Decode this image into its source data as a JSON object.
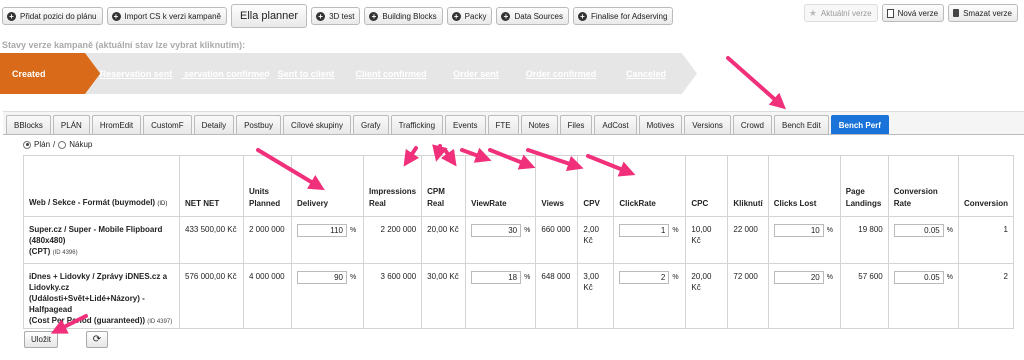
{
  "toolbar": {
    "add_position": "Přidat pozici do plánu",
    "import_cs": "Import CS k verzi kampaně",
    "ella_planner": "Ella planner",
    "test_3d": "3D test",
    "building_blocks": "Building Blocks",
    "packy": "Packy",
    "data_sources": "Data Sources",
    "finalise": "Finalise for Adserving",
    "current_version": "Aktuální verze",
    "new_version": "Nová verze",
    "delete_version": "Smazat verze"
  },
  "status": {
    "title": "Stavy verze kampaně (aktuální stav lze vybrat kliknutím):",
    "steps": [
      {
        "label": "Created"
      },
      {
        "label": "Reservation sent"
      },
      {
        "label": "Reservation confirmed"
      },
      {
        "label": "Sent to client"
      },
      {
        "label": "Client confirmed"
      },
      {
        "label": "Order sent"
      },
      {
        "label": "Order confirmed"
      },
      {
        "label": "Canceled"
      }
    ],
    "active_color": "#d86a1a",
    "inactive_color": "#e6e6e6"
  },
  "tabs": [
    "BBlocks",
    "PLÁN",
    "HromEdit",
    "CustomF",
    "Detaily",
    "Postbuy",
    "Cílové skupiny",
    "Grafy",
    "Trafficking",
    "Events",
    "FTE",
    "Notes",
    "Files",
    "AdCost",
    "Motives",
    "Versions",
    "Crowd",
    "Bench Edit",
    "Bench Perf"
  ],
  "active_tab": "Bench Perf",
  "radios": {
    "plan": "Plán",
    "separator": "/",
    "purchase": "Nákup"
  },
  "table": {
    "headers": {
      "name": "Web / Sekce - Formát (buymodel)",
      "name_id": "(ID)",
      "net_net": "NET NET",
      "units_planned": "Units Planned",
      "delivery": "Delivery",
      "impressions_real": "Impressions Real",
      "cpm_real": "CPM Real",
      "viewrate": "ViewRate",
      "views": "Views",
      "cpv": "CPV",
      "clickrate": "ClickRate",
      "cpc": "CPC",
      "clicks": "Kliknutí",
      "clicks_lost": "Clicks Lost",
      "page_landings": "Page Landings",
      "conversion_rate": "Conversion Rate",
      "conversion": "Conversion"
    },
    "rows": [
      {
        "name": "Super.cz / Super - Mobile Flipboard (480x480)",
        "model": "(CPT)",
        "id": "(ID 4396)",
        "net_net": "433 500,00 Kč",
        "units_planned": "2 000 000",
        "delivery": "110",
        "impressions_real": "2 200 000",
        "cpm_real": "20,00 Kč",
        "viewrate": "30",
        "views": "660 000",
        "cpv": "2,00 Kč",
        "clickrate": "1",
        "cpc": "10,00 Kč",
        "clicks": "22 000",
        "clicks_lost": "10",
        "page_landings": "19 800",
        "conversion_rate": "0.05",
        "conversion": "1"
      },
      {
        "name": "iDnes + Lidovky / Zprávy iDNES.cz a Lidovky.cz (Události+Svět+Lidé+Názory) - Halfpagead",
        "model": "(Cost Per Period (guaranteed))",
        "id": "(ID 4397)",
        "net_net": "576 000,00 Kč",
        "units_planned": "4 000 000",
        "delivery": "90",
        "impressions_real": "3 600 000",
        "cpm_real": "30,00 Kč",
        "viewrate": "18",
        "views": "648 000",
        "cpv": "3,00 Kč",
        "clickrate": "2",
        "cpc": "20,00 Kč",
        "clicks": "72 000",
        "clicks_lost": "20",
        "page_landings": "57 600",
        "conversion_rate": "0.05",
        "conversion": "2"
      }
    ],
    "percent": "%"
  },
  "buttons": {
    "save": "Uložit",
    "refresh_icon": "refresh-icon"
  },
  "annotation_color": "#f0307a"
}
